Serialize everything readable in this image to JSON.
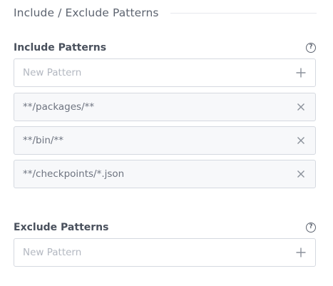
{
  "section": {
    "title": "Include / Exclude Patterns"
  },
  "include": {
    "label": "Include Patterns",
    "help_icon": "?",
    "new_placeholder": "New Pattern",
    "patterns": [
      "**/packages/**",
      "**/bin/**",
      "**/checkpoints/*.json"
    ]
  },
  "exclude": {
    "label": "Exclude Patterns",
    "help_icon": "?",
    "new_placeholder": "New Pattern",
    "patterns": []
  },
  "icons": {
    "add": "plus-icon",
    "remove": "close-icon",
    "help": "question-circle-icon"
  },
  "colors": {
    "border": "#d5d9e0",
    "text": "#6e7480",
    "placeholder": "#b3b8c1",
    "icon": "#8a909a"
  }
}
